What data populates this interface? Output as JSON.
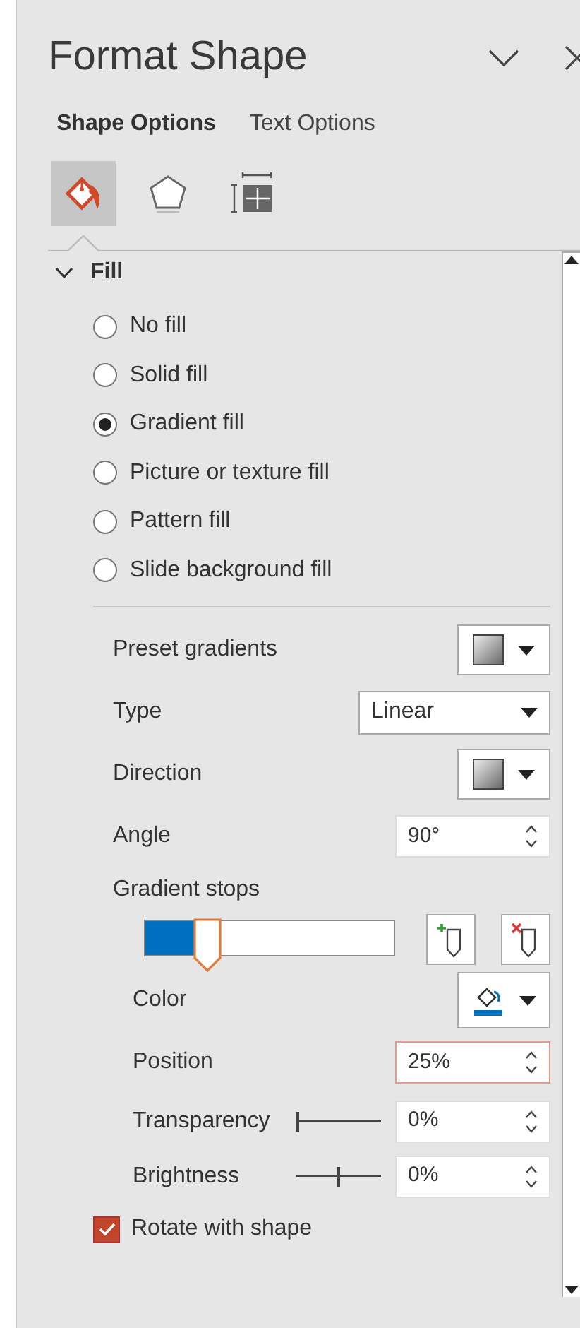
{
  "panel": {
    "title": "Format Shape"
  },
  "tabs": [
    {
      "label": "Shape Options",
      "selected": true
    },
    {
      "label": "Text Options",
      "selected": false
    }
  ],
  "category_icons": [
    {
      "kind": "fill",
      "selected": true
    },
    {
      "kind": "effects",
      "selected": false
    },
    {
      "kind": "size",
      "selected": false
    }
  ],
  "section": {
    "title": "Fill",
    "expanded": true
  },
  "fill_options": [
    {
      "label": "No fill",
      "selected": false
    },
    {
      "label": "Solid fill",
      "selected": false
    },
    {
      "label": "Gradient fill",
      "selected": true
    },
    {
      "label": "Picture or texture fill",
      "selected": false
    },
    {
      "label": "Pattern fill",
      "selected": false
    },
    {
      "label": "Slide background fill",
      "selected": false
    }
  ],
  "preset_gradients": {
    "label": "Preset gradients"
  },
  "type": {
    "label": "Type",
    "value": "Linear"
  },
  "direction": {
    "label": "Direction"
  },
  "angle": {
    "label": "Angle",
    "value": "90°"
  },
  "gradient_stops": {
    "label": "Gradient stops",
    "level": 0.25
  },
  "color": {
    "label": "Color"
  },
  "position": {
    "label": "Position",
    "value": "25%",
    "focused": true
  },
  "transparency": {
    "label": "Transparency",
    "value": "0%",
    "level": 0
  },
  "brightness": {
    "label": "Brightness",
    "value": "0%",
    "level": 0.5
  },
  "rotate_with_shape": {
    "label": "Rotate with shape",
    "checked": true
  }
}
